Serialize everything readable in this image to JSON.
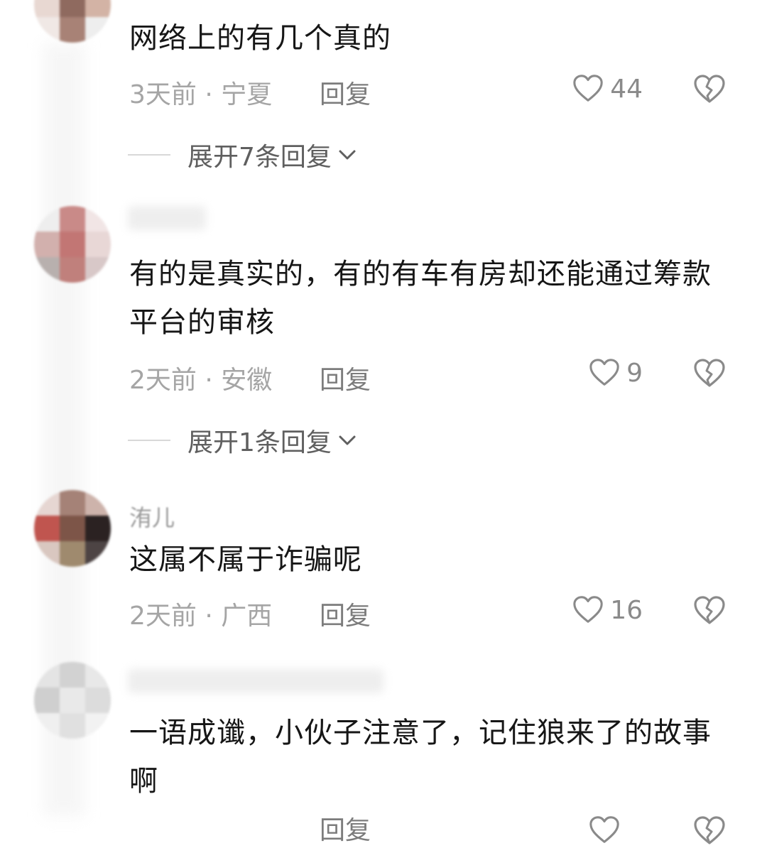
{
  "comments": [
    {
      "text": "网络上的有几个真的",
      "time_location": "3天前 · 宁夏",
      "reply_label": "回复",
      "likes": "44",
      "expand_label": "展开7条回复"
    },
    {
      "text": "有的是真实的，有的有车有房却还能通过筹款平台的审核",
      "time_location": "2天前 · 安徽",
      "reply_label": "回复",
      "likes": "9",
      "expand_label": "展开1条回复"
    },
    {
      "username": "洧儿",
      "text": "这属不属于诈骗呢",
      "time_location": "2天前 · 广西",
      "reply_label": "回复",
      "likes": "16"
    },
    {
      "text": "一语成谶，小伙子注意了，记住狼来了的故事啊",
      "time_location": "",
      "reply_label": "回复",
      "likes": ""
    }
  ],
  "icons": {
    "like": "heart-outline-icon",
    "dislike": "broken-heart-icon",
    "expand": "chevron-down-icon"
  },
  "colors": {
    "text": "#161616",
    "meta": "#a5a5a5",
    "reply": "#7c7c7c",
    "icon": "#8a8a8a"
  }
}
